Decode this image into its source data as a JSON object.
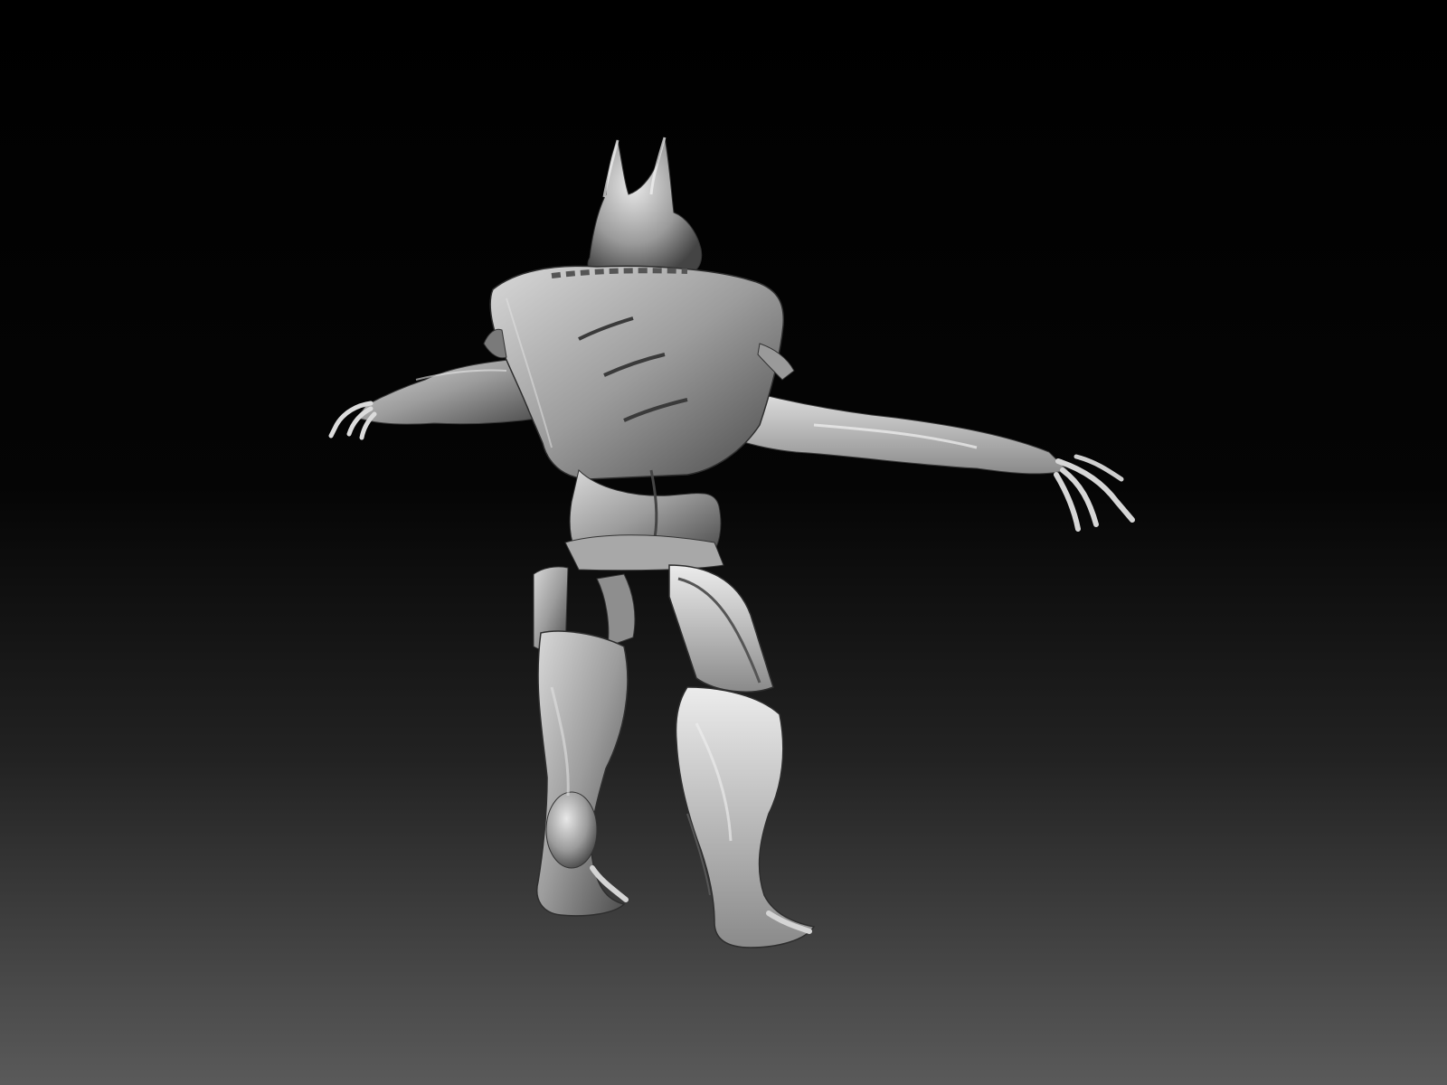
{
  "viewport": {
    "background_top_color": "#000000",
    "background_bottom_color": "#5a5a5a",
    "model_base_color": "#9a9a9a",
    "model_highlight_color": "#e6e6e6",
    "model_shadow_color": "#3a3a3a"
  },
  "model": {
    "subject": "sculpted-creature",
    "material": "grey-clay-matcap",
    "view": "back-three-quarter"
  }
}
